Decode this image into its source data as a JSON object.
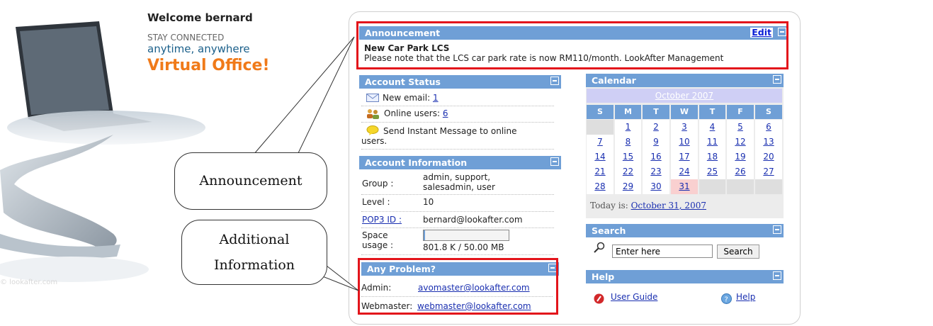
{
  "brand": {
    "welcome": "Welcome bernard",
    "stay": "STAY CONNECTED",
    "tagline": "anytime, anywhere",
    "product": "Virtual Office!",
    "copyright": "© lookafter.com"
  },
  "announcement": {
    "header": "Announcement",
    "edit_label": "Edit",
    "title": "New Car Park LCS",
    "body": "Please note that the LCS car park rate is now RM110/month. LookAfter Management"
  },
  "account_status": {
    "header": "Account Status",
    "new_email_label": "New email:",
    "new_email_count": "1",
    "online_label": "Online users:",
    "online_count": "6",
    "send_im_line1": "Send Instant Message to online",
    "send_im_line2": "users."
  },
  "account_info": {
    "header": "Account Information",
    "group_label": "Group :",
    "group_value_line1": "admin, support,",
    "group_value_line2": "salesadmin, user",
    "level_label": "Level :",
    "level_value": "10",
    "pop3_label": "POP3 ID :",
    "pop3_value": "bernard@lookafter.com",
    "space_label_line1": "Space",
    "space_label_line2": "usage :",
    "space_value": "801.8 K / 50.00 MB",
    "space_used_fraction": 0.016
  },
  "any_problem": {
    "header": "Any Problem?",
    "admin_label": "Admin:",
    "admin_email": "avomaster@lookafter.com",
    "webmaster_label": "Webmaster:",
    "webmaster_email": "webmaster@lookafter.com"
  },
  "calendar": {
    "header": "Calendar",
    "month": "October 2007",
    "weekdays": [
      "S",
      "M",
      "T",
      "W",
      "T",
      "F",
      "S"
    ],
    "start_offset": 1,
    "days": [
      "1",
      "2",
      "3",
      "4",
      "5",
      "6",
      "7",
      "8",
      "9",
      "10",
      "11",
      "12",
      "13",
      "14",
      "15",
      "16",
      "17",
      "18",
      "19",
      "20",
      "21",
      "22",
      "23",
      "24",
      "25",
      "26",
      "27",
      "28",
      "29",
      "30",
      "31"
    ],
    "today_day": "31",
    "today_label": "Today is:",
    "today_link": "October 31, 2007"
  },
  "search": {
    "header": "Search",
    "input_value": "Enter here",
    "button_label": "Search"
  },
  "help": {
    "header": "Help",
    "user_guide_label": "User Guide",
    "help_label": "Help"
  },
  "callouts": {
    "announcement": "Announcement",
    "additional_line1": "Additional",
    "additional_line2": "Information"
  },
  "colors": {
    "header_bar": "#6f9fd6",
    "highlight_border": "#e3141b",
    "today_cell": "#f9d0d0",
    "link": "#1a2fb0"
  }
}
